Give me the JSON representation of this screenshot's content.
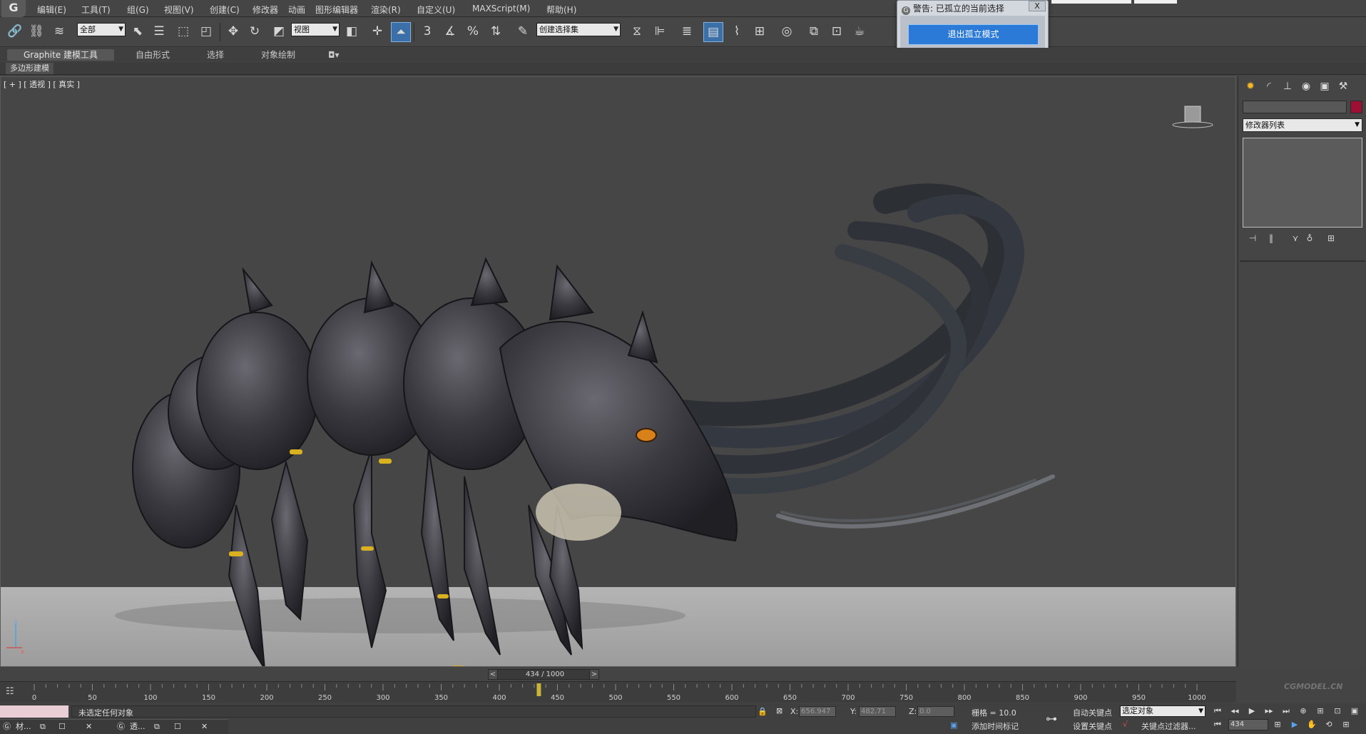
{
  "menu": {
    "items": [
      "编辑(E)",
      "工具(T)",
      "组(G)",
      "视图(V)",
      "创建(C)",
      "修改器",
      "动画",
      "图形编辑器",
      "渲染(R)",
      "自定义(U)",
      "MAXScript(M)",
      "帮助(H)"
    ]
  },
  "toolbar": {
    "selection_filter": "全部",
    "reference_coord": "视图",
    "named_selection": "创建选择集",
    "snap_label": "3"
  },
  "warning": {
    "title": "警告: 已孤立的当前选择",
    "close": "X",
    "button": "退出孤立模式"
  },
  "ribbon": {
    "tabs": [
      "Graphite 建模工具",
      "自由形式",
      "选择",
      "对象绘制"
    ],
    "subtab": "多边形建模"
  },
  "viewport": {
    "label": "[ + ] [ 透视 ] [ 真实 ]",
    "axis": {
      "z": "z",
      "x": "x"
    }
  },
  "command_panel": {
    "modifier_list": "修改器列表",
    "object_color": "#9c1035"
  },
  "timeline": {
    "current_frame": 434,
    "total_frames": 1000,
    "label": "434 / 1000",
    "prev": "<",
    "next": ">",
    "ticks": [
      0,
      50,
      100,
      150,
      200,
      250,
      300,
      350,
      400,
      450,
      500,
      550,
      600,
      650,
      700,
      750,
      800,
      850,
      900,
      950,
      1000
    ]
  },
  "status": {
    "message": "未选定任何对象",
    "x_label": "X:",
    "x_value": "656.947",
    "y_label": "Y:",
    "y_value": "482.71",
    "z_label": "Z:",
    "z_value": "0.0",
    "grid": "栅格 = 10.0",
    "add_time_tag": "添加时间标记",
    "auto_key": "自动关键点",
    "set_key": "设置关键点",
    "selected_dropdown": "选定对象",
    "key_filters": "关键点过滤器...",
    "frame_field": "434"
  },
  "taskbar": {
    "item1": "材...",
    "item2": "透..."
  },
  "watermark": "CGMODEL.CN"
}
